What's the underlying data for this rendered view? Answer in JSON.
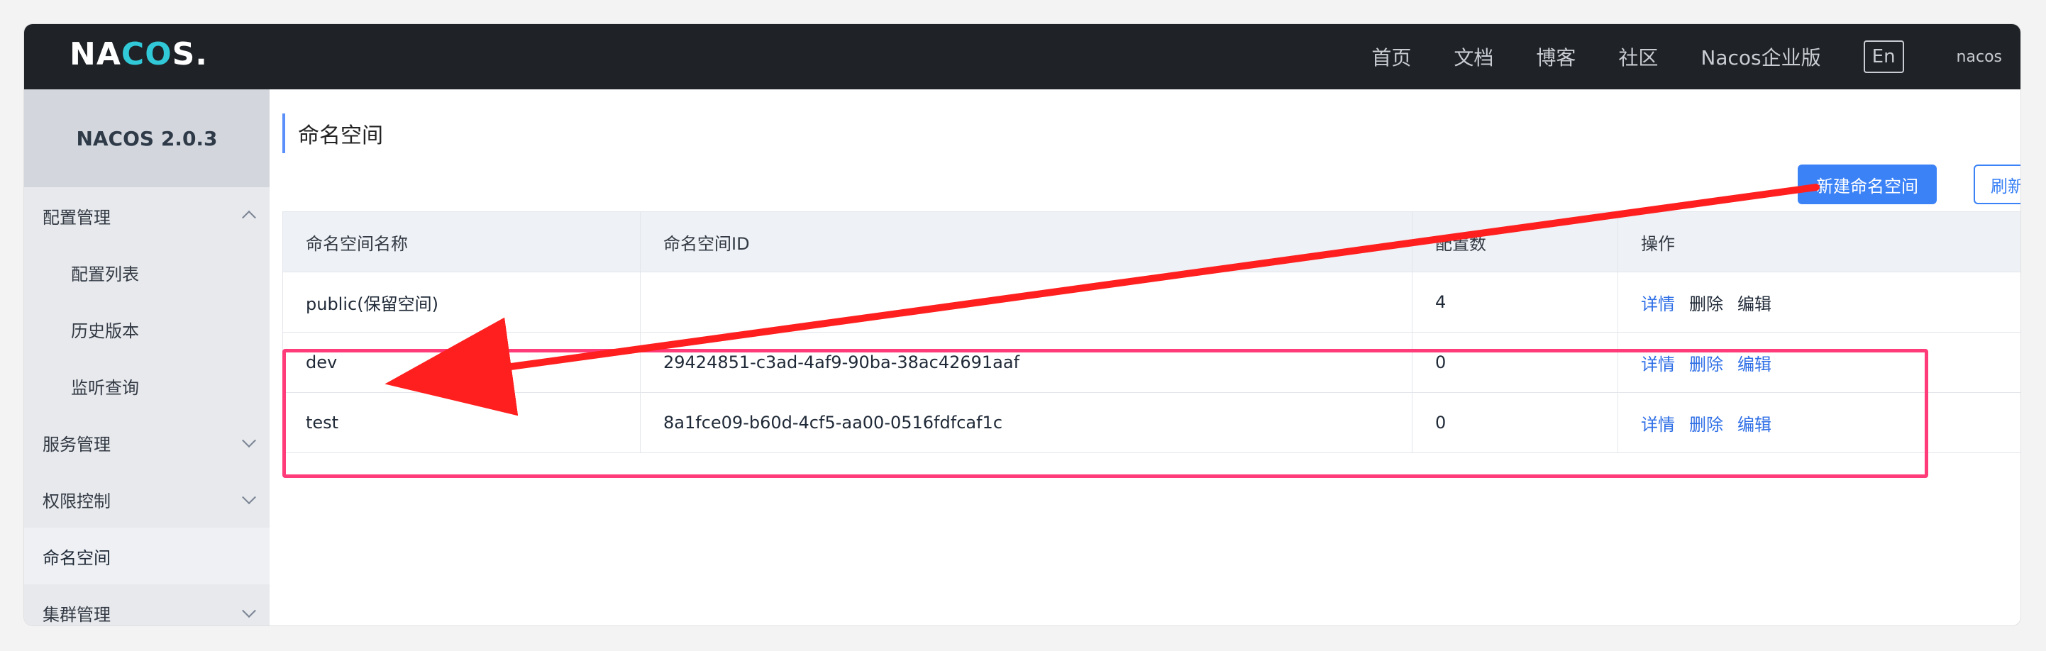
{
  "topbar": {
    "logo_prefix": "NA",
    "logo_mid": "C",
    "logo_o": "O",
    "logo_suffix": "S.",
    "nav": [
      "首页",
      "文档",
      "博客",
      "社区",
      "Nacos企业版"
    ],
    "lang_label": "En",
    "user_label": "nacos"
  },
  "sidebar": {
    "brand": "NACOS 2.0.3",
    "items": [
      {
        "label": "配置管理"
      },
      {
        "label": "配置列表"
      },
      {
        "label": "历史版本"
      },
      {
        "label": "监听查询"
      },
      {
        "label": "服务管理"
      },
      {
        "label": "权限控制"
      },
      {
        "label": "命名空间"
      },
      {
        "label": "集群管理"
      }
    ]
  },
  "main": {
    "title": "命名空间",
    "buttons": {
      "new_label": "新建命名空间",
      "refresh_label": "刷新"
    },
    "table": {
      "headers": [
        "命名空间名称",
        "命名空间ID",
        "配置数",
        "操作"
      ],
      "rows": [
        {
          "name": "public(保留空间)",
          "id": "",
          "count": "4",
          "actions": [
            "详情",
            "删除",
            "编辑"
          ]
        },
        {
          "name": "dev",
          "id": "29424851-c3ad-4af9-90ba-38ac42691aaf",
          "count": "0",
          "actions": [
            "详情",
            "删除",
            "编辑"
          ]
        },
        {
          "name": "test",
          "id": "8a1fce09-b60d-4cf5-aa00-0516fdfcaf1c",
          "count": "0",
          "actions": [
            "详情",
            "删除",
            "编辑"
          ]
        }
      ]
    }
  },
  "colors": {
    "primary": "#3b82f6",
    "accent_logo": "#31c9d8",
    "annotation_red": "#ff1f1f",
    "annotation_pink": "#ff3b7a"
  }
}
